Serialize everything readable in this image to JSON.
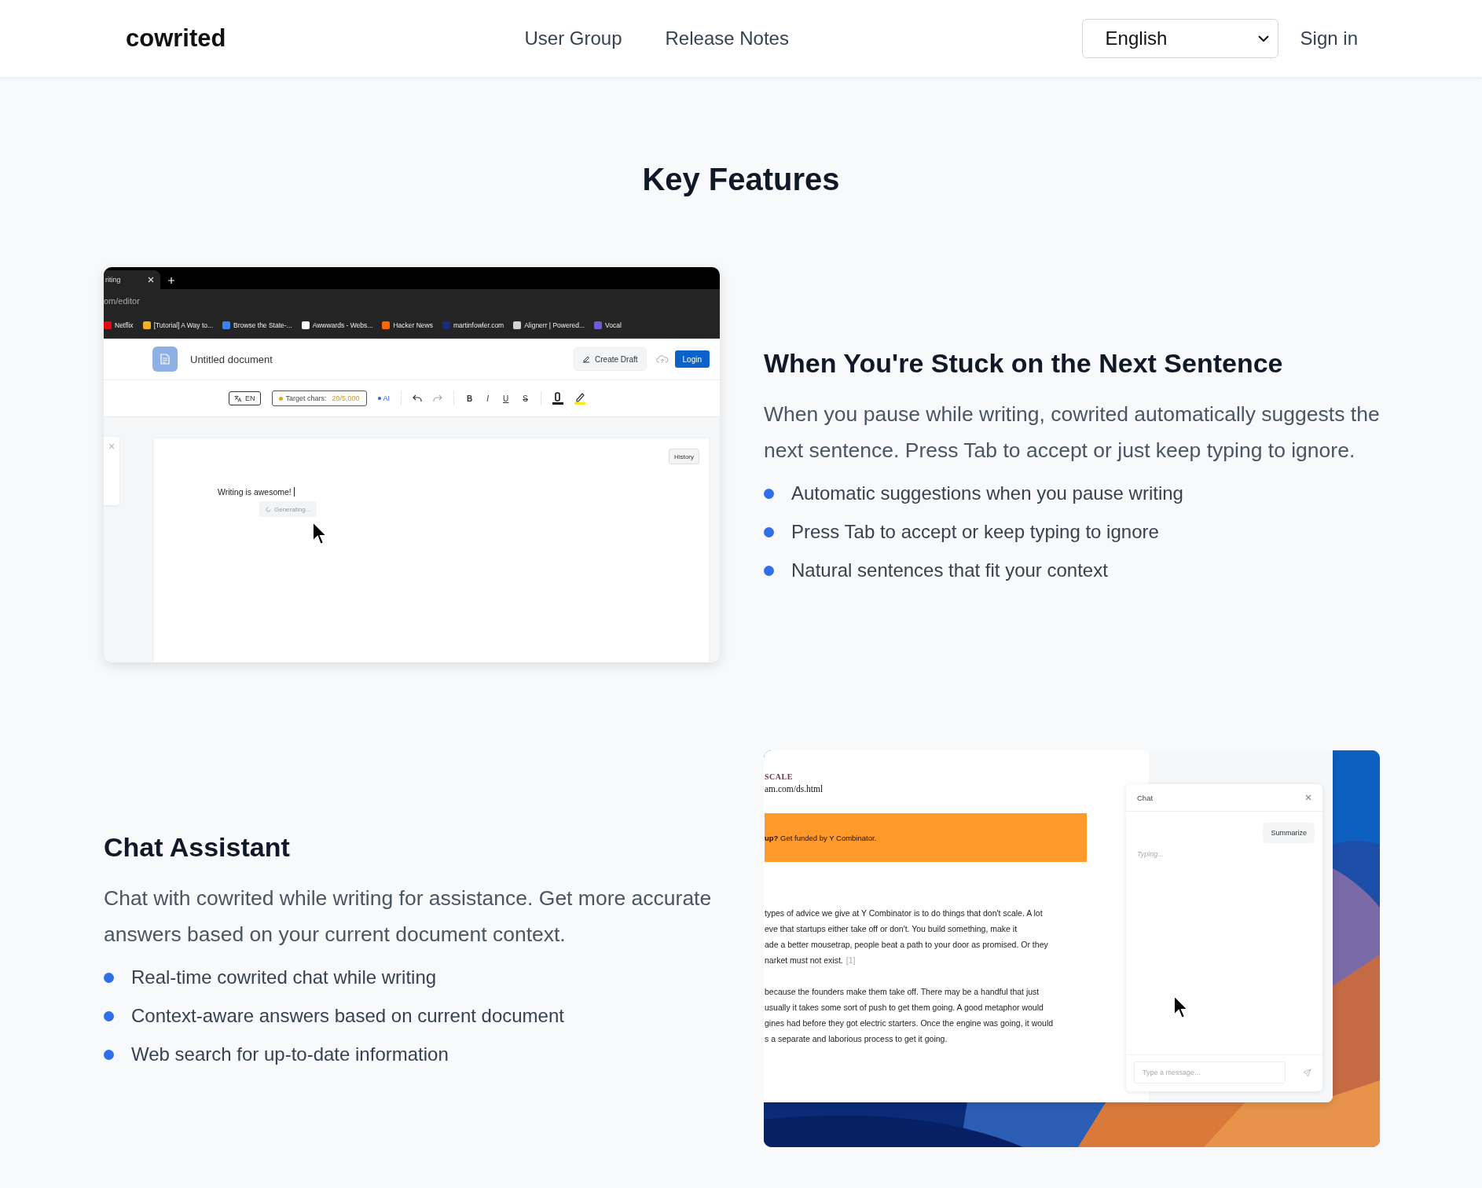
{
  "nav": {
    "logo": "cowrited",
    "links": [
      "User Group",
      "Release Notes"
    ],
    "language": "English",
    "sign_in": "Sign in"
  },
  "title": "Key Features",
  "features": [
    {
      "kind": "editor",
      "heading": "When You're Stuck on the Next Sentence",
      "paragraph": "When you pause while writing, cowrited automatically suggests the next sentence. Press Tab to accept or just keep typing to ignore.",
      "bullets": [
        "Automatic suggestions when you pause writing",
        "Press Tab to accept or keep typing to ignore",
        "Natural sentences that fit your context"
      ],
      "screenshot": {
        "tab": "riting",
        "address": "om/editor",
        "bookmarks": [
          {
            "label": "Netflix",
            "color": "#e50914"
          },
          {
            "label": "[Tutorial] A Way to...",
            "color": "#f2b01e"
          },
          {
            "label": "Browse the State-...",
            "color": "#3b82f6"
          },
          {
            "label": "Awwwards - Webs...",
            "color": "#ffffff"
          },
          {
            "label": "Hacker News",
            "color": "#ff6600"
          },
          {
            "label": "martinfowler.com",
            "color": "#1e2a78"
          },
          {
            "label": "Alignerr | Powered...",
            "color": "#d1d5db"
          },
          {
            "label": "Vocal",
            "color": "#6b5bd6"
          }
        ],
        "doc_title": "Untitled document",
        "create_draft": "Create Draft",
        "login": "Login",
        "language": "EN",
        "target_label": "Target chars:",
        "target_value": "20/5,000",
        "ai": "AI",
        "format": [
          {
            "label": "B",
            "kind": "bold"
          },
          {
            "label": "I",
            "kind": "italic"
          },
          {
            "label": "U",
            "kind": "underline"
          },
          {
            "label": "S",
            "kind": "strike"
          }
        ],
        "history": "History",
        "text": "Writing is awesome!",
        "generating": "Generating..."
      }
    },
    {
      "kind": "chat",
      "heading": "Chat Assistant",
      "paragraph": "Chat with cowrited while writing for assistance. Get more accurate answers based on your current document context.",
      "bullets": [
        "Real-time cowrited chat while writing",
        "Context-aware answers based on current document",
        "Web search for up-to-date information"
      ],
      "screenshot": {
        "doc_heading": "SCALE",
        "url": "am.com/ds.html",
        "banner": "**up?** Get funded by Y Combinator.",
        "paragraphs": [
          {
            "lines": [
              {
                "text": "types of advice we give at Y Combinator is to do things that don't scale. A lot"
              },
              {
                "text": "eve that startups either take off or don't. You build something, make it"
              },
              {
                "text": "ade a better mousetrap, people beat a path to your door as promised. Or they"
              },
              {
                "text": "narket must not exist.",
                "note": "[1]"
              }
            ]
          },
          {
            "lines": [
              {
                "text": "because the founders make them take off. There may be a handful that just"
              },
              {
                "text": "usually it takes some sort of push to get them going. A good metaphor would"
              },
              {
                "text": "gines had before they got electric starters. Once the engine was going, it would"
              },
              {
                "text": "s a separate and laborious process to get it going."
              }
            ]
          }
        ],
        "chat_title": "Chat",
        "suggestion": "Summarize",
        "status": "Typing...",
        "placeholder": "Type a message..."
      }
    }
  ]
}
